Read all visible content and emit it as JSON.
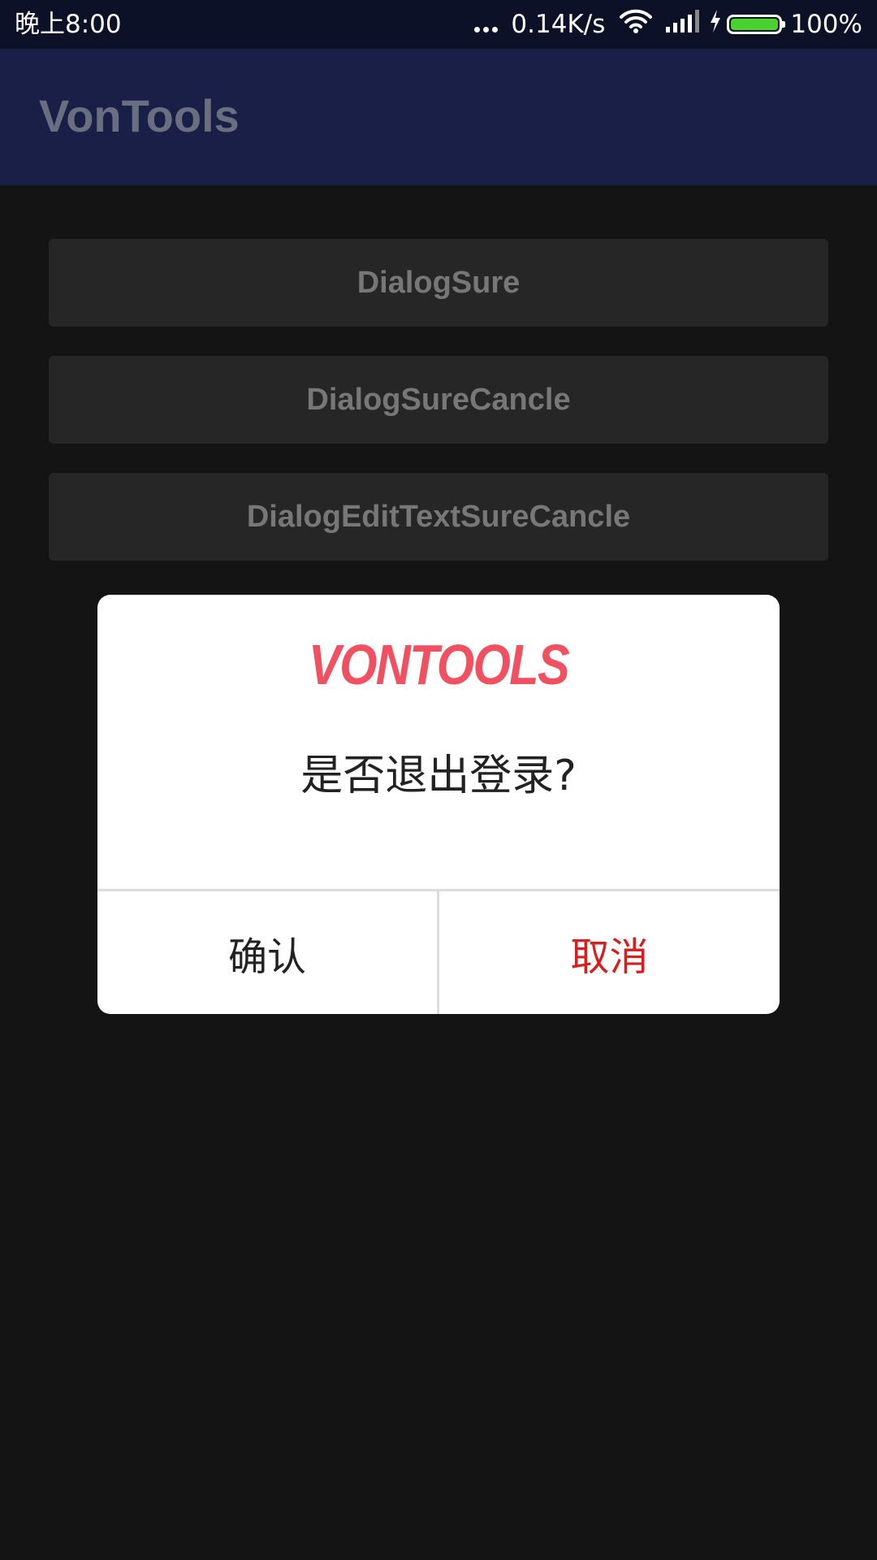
{
  "status_bar": {
    "time": "晚上8:00",
    "net_speed": "0.14K/s",
    "battery_percent": "100%",
    "battery_level": 1.0,
    "icons": [
      "more-dots-icon",
      "wifi-icon",
      "signal-icon",
      "charging-icon",
      "battery-icon"
    ],
    "battery_color": "#49d12e"
  },
  "app_bar": {
    "title": "VonTools",
    "background": "#1a1f48"
  },
  "buttons": [
    {
      "label": "DialogSure"
    },
    {
      "label": "DialogSureCancle"
    },
    {
      "label": "DialogEditTextSureCancle"
    }
  ],
  "dialog": {
    "logo_text": "VONTOOLS",
    "logo_color": "#f0505f",
    "message": "是否退出登录?",
    "confirm_label": "确认",
    "cancel_label": "取消",
    "cancel_color": "#d81e1e"
  }
}
